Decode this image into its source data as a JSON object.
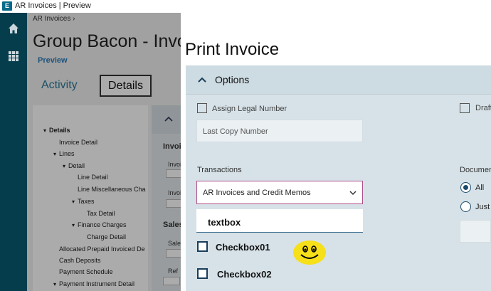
{
  "window": {
    "title": "AR Invoices | Preview",
    "app_icon": "E"
  },
  "rail": {
    "icons": [
      "home-icon",
      "grid-icon"
    ]
  },
  "background_page": {
    "breadcrumb": "AR Invoices  ›",
    "title": "Group Bacon - Invo",
    "preview_link": "Preview",
    "tabs": {
      "activity": "Activity",
      "details": "Details"
    },
    "tree": [
      {
        "label": "Details",
        "caret": "▾",
        "bold": true
      },
      {
        "label": "Invoice Detail"
      },
      {
        "label": "Lines",
        "caret": "▾"
      },
      {
        "label": "Detail",
        "caret": "▾"
      },
      {
        "label": "Line Detail"
      },
      {
        "label": "Line Miscellaneous Cha"
      },
      {
        "label": "Taxes",
        "caret": "▾"
      },
      {
        "label": "Tax Detail"
      },
      {
        "label": "Finance Charges",
        "caret": "▾"
      },
      {
        "label": "Charge Detail"
      },
      {
        "label": "Allocated Prepaid Invoiced De"
      },
      {
        "label": "Cash Deposits"
      },
      {
        "label": "Payment Schedule"
      },
      {
        "label": "Payment Instrument Detail",
        "caret": "▾"
      }
    ],
    "right_panel": {
      "heading": "Invoi",
      "field1": "Invoic",
      "field2": "Invoi",
      "section2": "Sales",
      "field3": "Sale",
      "field4": "Ref"
    }
  },
  "dialog": {
    "title": "Print Invoice",
    "options_label": "Options",
    "assign_legal_number": {
      "label": "Assign Legal Number",
      "checked": false
    },
    "draft": {
      "label": "Draft",
      "checked": false
    },
    "last_copy_number": {
      "placeholder": "Last Copy Number"
    },
    "transactions": {
      "label": "Transactions",
      "value": "AR Invoices and Credit Memos"
    },
    "textbox": {
      "value": "textbox"
    },
    "checkbox01": {
      "label": "Checkbox01",
      "checked": false
    },
    "checkbox02": {
      "label": "Checkbox02",
      "checked": false
    },
    "document": {
      "label": "Documen",
      "options": [
        {
          "label": "All",
          "selected": true
        },
        {
          "label": "Just",
          "selected": false
        }
      ]
    }
  },
  "colors": {
    "rail": "#053d4d",
    "accent": "#2b79b7",
    "panel": "#d6e2e8",
    "select_border": "#b0508a",
    "smiley": "#f5e01a"
  }
}
